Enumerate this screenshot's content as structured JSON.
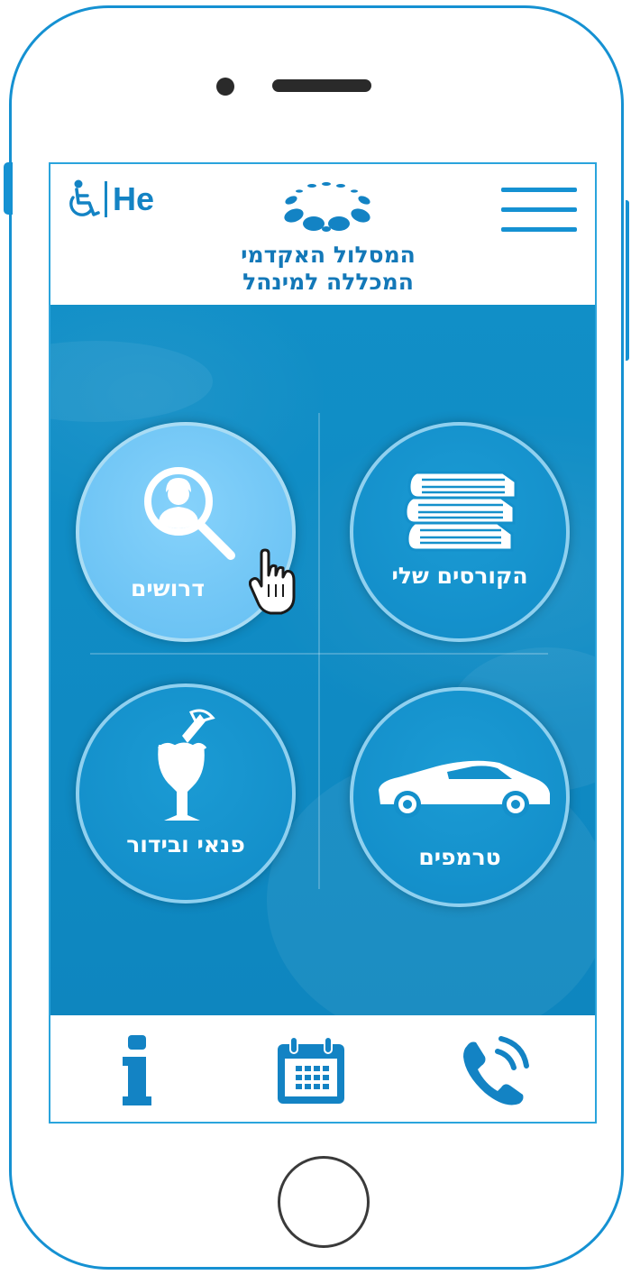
{
  "header": {
    "language": "He",
    "logo_line1": "המסלול האקדמי",
    "logo_line2": "המכללה למינהל"
  },
  "tiles": [
    {
      "label": "הקורסים שלי",
      "icon": "books-icon",
      "active": false
    },
    {
      "label": "דרושים",
      "icon": "person-search-icon",
      "active": true
    },
    {
      "label": "טרמפים",
      "icon": "car-icon",
      "active": false
    },
    {
      "label": "פנאי ובידור",
      "icon": "cocktail-icon",
      "active": false
    }
  ],
  "bottom_bar": [
    "phone-icon",
    "calendar-icon",
    "info-icon"
  ],
  "colors": {
    "brand": "#1591d2",
    "main_bg": "#118fc7",
    "active_tile": "#6cc3f4",
    "title_text": "#1378b8"
  }
}
